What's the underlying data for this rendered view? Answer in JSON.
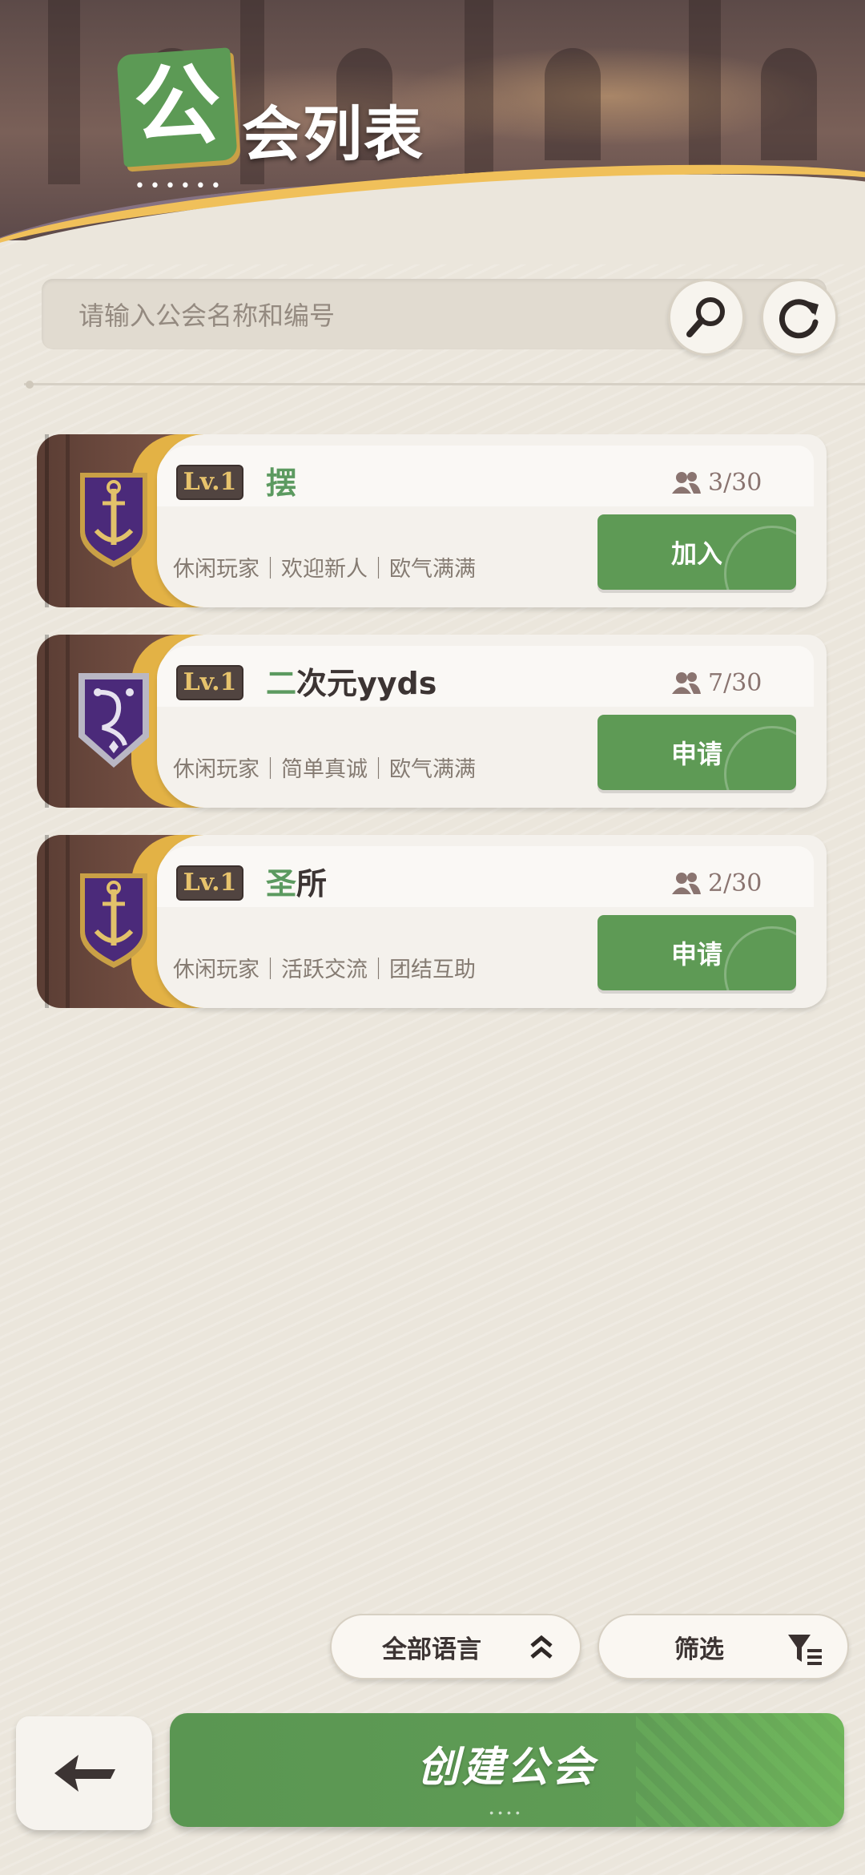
{
  "header": {
    "title_first_char": "公",
    "title_rest": "会列表"
  },
  "search": {
    "placeholder": "请输入公会名称和编号"
  },
  "guilds": [
    {
      "level": "Lv.1",
      "name_first": "摆",
      "name_rest": "",
      "members": "3/30",
      "tags": "休闲玩家｜欢迎新人｜欧气满满",
      "action": "加入",
      "crest": "anchor-crest-icon"
    },
    {
      "level": "Lv.1",
      "name_first": "二",
      "name_rest": "次元yyds",
      "members": "7/30",
      "tags": "休闲玩家｜简单真诚｜欧气满满",
      "action": "申请",
      "crest": "dragon-crest-icon"
    },
    {
      "level": "Lv.1",
      "name_first": "圣",
      "name_rest": "所",
      "members": "2/30",
      "tags": "休闲玩家｜活跃交流｜团结互助",
      "action": "申请",
      "crest": "anchor-crest-icon"
    }
  ],
  "filters": {
    "language_label": "全部语言",
    "filter_label": "筛选"
  },
  "footer": {
    "create_label": "创建公会"
  },
  "colors": {
    "accent_green": "#5e9a55",
    "gold": "#e3b245",
    "crest_purple": "#4b2a7a",
    "background": "#ebe6dc"
  }
}
